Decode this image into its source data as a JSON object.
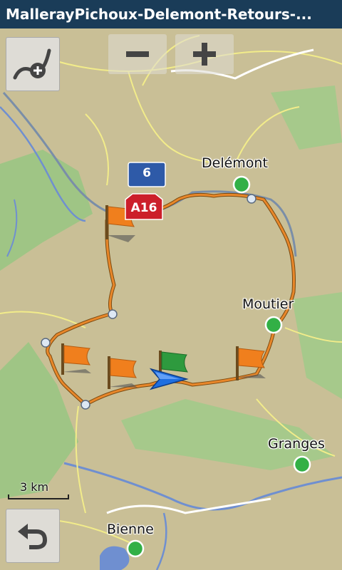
{
  "header": {
    "title": "MallerayPichoux-Delemont-Retours-..."
  },
  "toolbar": {
    "zoom_out_icon": "minus-icon",
    "zoom_in_icon": "plus-icon",
    "route_button_icon": "route-add-icon",
    "back_button_icon": "back-arrow-icon"
  },
  "map": {
    "road_shields": [
      {
        "label": "6",
        "color": "#2e5aa8"
      },
      {
        "label": "A16",
        "color": "#cc1f2a"
      }
    ],
    "cities": [
      "Delémont",
      "Moutier",
      "Granges",
      "Bienne"
    ],
    "scale": "3 km",
    "colors": {
      "land": "#c9bf96",
      "forest": "#9fc585",
      "water": "#6f8fd0",
      "route": "#e8872a",
      "road": "#f2ec8a",
      "city_marker": "#32b046",
      "flag_orange": "#f07f1d",
      "flag_green": "#2e9a3e",
      "position_arrow": "#1f6fe0"
    }
  }
}
